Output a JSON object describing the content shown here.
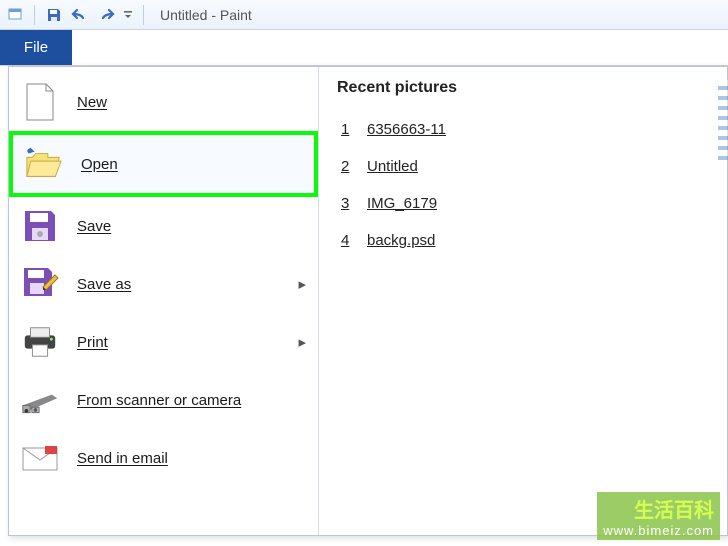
{
  "title": "Untitled - Paint",
  "file_tab": "File",
  "menu": {
    "new": "New",
    "open": "Open",
    "save": "Save",
    "saveas": "Save as",
    "print": "Print",
    "scanner": "From scanner or camera",
    "email": "Send in email"
  },
  "recent": {
    "header": "Recent pictures",
    "items": [
      {
        "n": "1",
        "name": "6356663-11"
      },
      {
        "n": "2",
        "name": "Untitled"
      },
      {
        "n": "3",
        "name": "IMG_6179"
      },
      {
        "n": "4",
        "name": "backg.psd"
      }
    ]
  },
  "watermark": {
    "cn": "生活百科",
    "url": "www.bimeiz.com"
  }
}
